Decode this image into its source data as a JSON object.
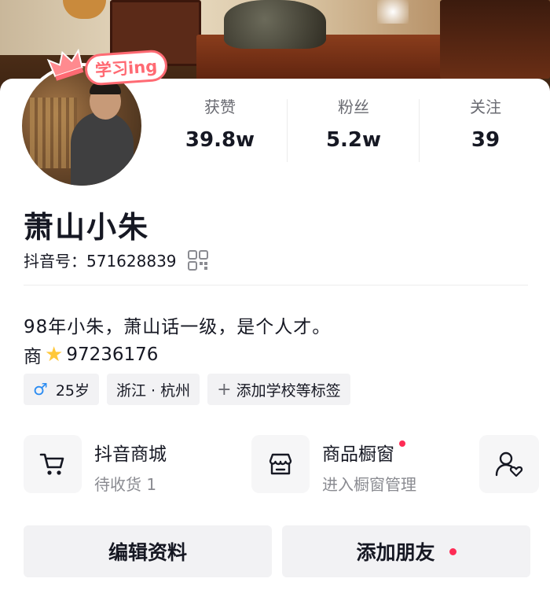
{
  "sticker": {
    "text": "学习ing"
  },
  "stats": [
    {
      "label": "获赞",
      "value": "39.8w"
    },
    {
      "label": "粉丝",
      "value": "5.2w"
    },
    {
      "label": "关注",
      "value": "39"
    }
  ],
  "profile": {
    "name": "萧山小朱",
    "id_line": "抖音号：571628839",
    "bio_line1": "98年小朱，萧山话一级，是个人才。",
    "bio_line2_prefix": "商",
    "bio_line2_number": "97236176"
  },
  "tags": {
    "gender_age": "25岁",
    "location": "浙江 · 杭州",
    "add_school": "添加学校等标签"
  },
  "shop": {
    "mall_title": "抖音商城",
    "mall_sub": "待收货 1",
    "window_title": "商品橱窗",
    "window_sub": "进入橱窗管理"
  },
  "buttons": {
    "edit": "编辑资料",
    "add_friend": "添加朋友"
  },
  "colors": {
    "accent_red": "#fe2c55",
    "male_blue": "#2b8cf2",
    "sticker_pink": "#ff6a73"
  },
  "icons": [
    "crown-icon",
    "qr-code-icon",
    "male-icon",
    "star-icon",
    "plus-icon",
    "cart-icon",
    "shop-window-icon",
    "friends-icon"
  ]
}
